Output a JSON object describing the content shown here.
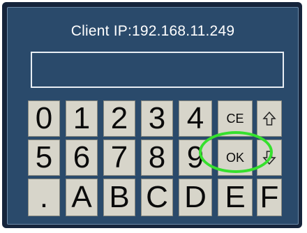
{
  "header": {
    "title": "Client IP:192.168.11.249"
  },
  "input": {
    "value": ""
  },
  "keypad": {
    "row1": [
      "0",
      "1",
      "2",
      "3",
      "4",
      "CE"
    ],
    "row2": [
      "5",
      "6",
      "7",
      "8",
      "9",
      "OK"
    ],
    "row3": [
      ".",
      "A",
      "B",
      "C",
      "D",
      "E",
      "F"
    ]
  },
  "icons": {
    "up": "arrow-up-outline-icon",
    "down": "arrow-down-outline-icon"
  },
  "colors": {
    "panel": "#2a4a6b",
    "frame": "#15243b",
    "key": "#d7d5ca",
    "highlight": "#36e02e"
  }
}
